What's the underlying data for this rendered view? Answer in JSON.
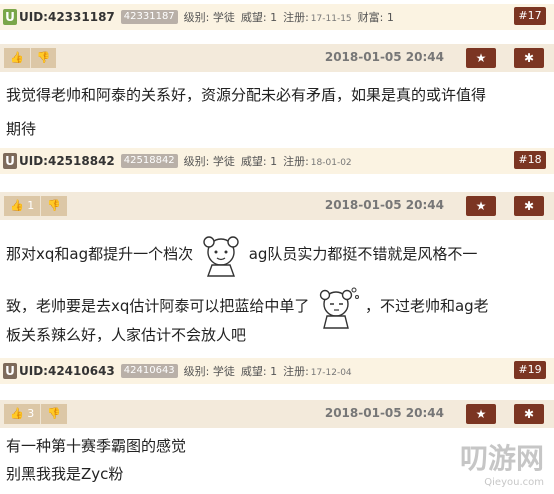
{
  "posts": [
    {
      "uid_label": "UID:42331187",
      "uid_chip": "42331187",
      "level": "级别: 学徒",
      "fame": "威望: 1",
      "reg_label": "注册:",
      "reg_date": "17-11-15",
      "wealth": "财富: 1",
      "floor": "#17",
      "date": "2018-01-05 20:44",
      "likes": "",
      "lines": [
        "我觉得老帅和阿泰的关系好，资源分配未必有矛盾，如果是真的或许值得",
        "期待"
      ]
    },
    {
      "uid_label": "UID:42518842",
      "uid_chip": "42518842",
      "level": "级别: 学徒",
      "fame": "威望: 1",
      "reg_label": "注册:",
      "reg_date": "18-01-02",
      "floor": "#18",
      "date": "2018-01-05 20:44",
      "likes": "1",
      "lines": [
        "那对xq和ag都提升一个档次",
        "ag队员实力都挺不错就是风格不一",
        "致，老帅要是去xq估计阿泰可以把蓝给中单了",
        "，不过老帅和ag老",
        "板关系辣么好，人家估计不会放人吧"
      ]
    },
    {
      "uid_label": "UID:42410643",
      "uid_chip": "42410643",
      "level": "级别: 学徒",
      "fame": "威望: 1",
      "reg_label": "注册:",
      "reg_date": "17-12-04",
      "floor": "#19",
      "date": "2018-01-05 20:44",
      "likes": "3",
      "lines": [
        "有一种第十赛季霸图的感觉",
        "别黑我我是Zyc粉"
      ]
    }
  ],
  "icons": {
    "u": "U",
    "thumb_up": "👍",
    "thumb_down": "👎",
    "star": "★",
    "gear": "✱"
  },
  "watermark": {
    "text": "叨游网",
    "url": "Qieyou.com"
  },
  "colors": {
    "brown": "#7b3522",
    "tan": "#dcc7a6",
    "user_bg": "#fbf3e2",
    "action_bg": "#f3eadb"
  }
}
